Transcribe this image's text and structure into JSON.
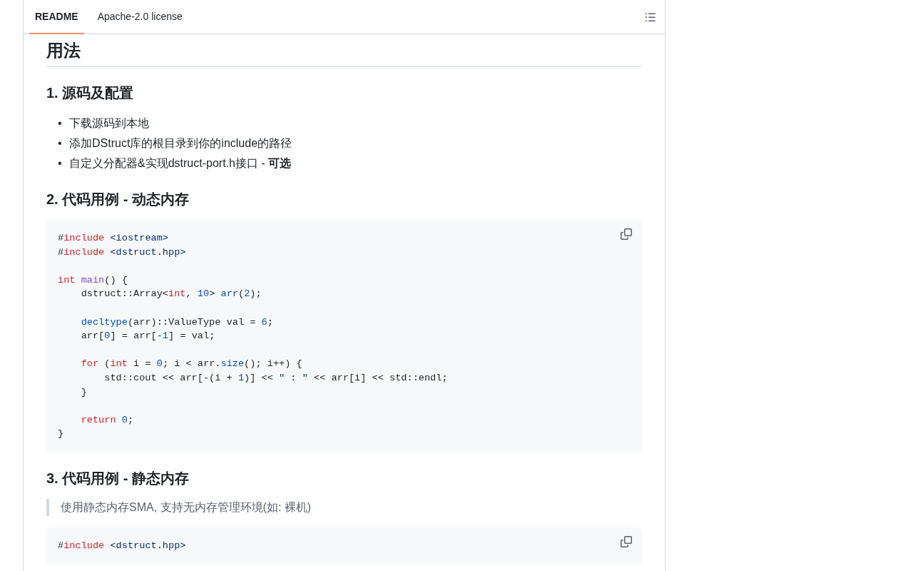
{
  "tabs": [
    {
      "label": "README",
      "selected": true
    },
    {
      "label": "Apache-2.0 license",
      "selected": false
    }
  ],
  "content": [
    {
      "kind": "h2",
      "text": "用法"
    },
    {
      "kind": "h3",
      "text": "1. 源码及配置"
    },
    {
      "kind": "list",
      "marker": "•",
      "items": [
        "下载源码到本地",
        "添加DStruct库的根目录到你的include的路径",
        "自定义分配器&实现dstruct-port.h接口 - **可选**"
      ]
    },
    {
      "kind": "h3",
      "text": "2. 代码用例 - 动态内存"
    },
    {
      "kind": "code",
      "tokens": [
        {
          "kind": "plain",
          "text": "#"
        },
        {
          "kind": "keyword",
          "text": "include"
        },
        {
          "kind": "string",
          "text": " <iostream>"
        },
        {
          "kind": "plain",
          "text": "\n#"
        },
        {
          "kind": "keyword",
          "text": "include"
        },
        {
          "kind": "string",
          "text": " <dstruct.hpp>"
        },
        {
          "kind": "keyword",
          "text": "\n\nint"
        },
        {
          "kind": "function",
          "text": " main"
        },
        {
          "kind": "plain",
          "text": "() {\n    dstruct::Array<"
        },
        {
          "kind": "keyword",
          "text": "int"
        },
        {
          "kind": "plain",
          "text": ", "
        },
        {
          "kind": "number",
          "text": "10"
        },
        {
          "kind": "plain",
          "text": ">"
        },
        {
          "kind": "number",
          "text": " arr"
        },
        {
          "kind": "plain",
          "text": "("
        },
        {
          "kind": "number",
          "text": "2"
        },
        {
          "kind": "plain",
          "text": ");"
        },
        {
          "kind": "number",
          "text": "\n\n    decltype"
        },
        {
          "kind": "plain",
          "text": "(arr)::ValueType val = "
        },
        {
          "kind": "number",
          "text": "6"
        },
        {
          "kind": "plain",
          "text": ";\n    arr["
        },
        {
          "kind": "number",
          "text": "0"
        },
        {
          "kind": "plain",
          "text": "] = arr[-"
        },
        {
          "kind": "number",
          "text": "1"
        },
        {
          "kind": "plain",
          "text": "] = val;"
        },
        {
          "kind": "keyword",
          "text": "\n\n    for"
        },
        {
          "kind": "plain",
          "text": " ("
        },
        {
          "kind": "keyword",
          "text": "int"
        },
        {
          "kind": "plain",
          "text": " i = "
        },
        {
          "kind": "number",
          "text": "0"
        },
        {
          "kind": "plain",
          "text": "; i < arr."
        },
        {
          "kind": "number",
          "text": "size"
        },
        {
          "kind": "plain",
          "text": "(); i++) {\n        std::cout << arr[-(i + "
        },
        {
          "kind": "number",
          "text": "1"
        },
        {
          "kind": "plain",
          "text": ")] <<"
        },
        {
          "kind": "string",
          "text": " \" : \""
        },
        {
          "kind": "plain",
          "text": " << arr[i] << std::endl;\n    }"
        },
        {
          "kind": "keyword",
          "text": "\n\n    return"
        },
        {
          "kind": "number",
          "text": " 0"
        },
        {
          "kind": "plain",
          "text": ";\n}"
        }
      ]
    },
    {
      "kind": "h3",
      "text": "3. 代码用例 - 静态内存"
    },
    {
      "kind": "quote",
      "text": "使用静态内存SMA, 支持无内存管理环境(如: 裸机)"
    },
    {
      "kind": "code",
      "tokens": [
        {
          "kind": "plain",
          "text": "#"
        },
        {
          "kind": "keyword",
          "text": "include"
        },
        {
          "kind": "string",
          "text": " <dstruct.hpp>"
        }
      ]
    }
  ]
}
